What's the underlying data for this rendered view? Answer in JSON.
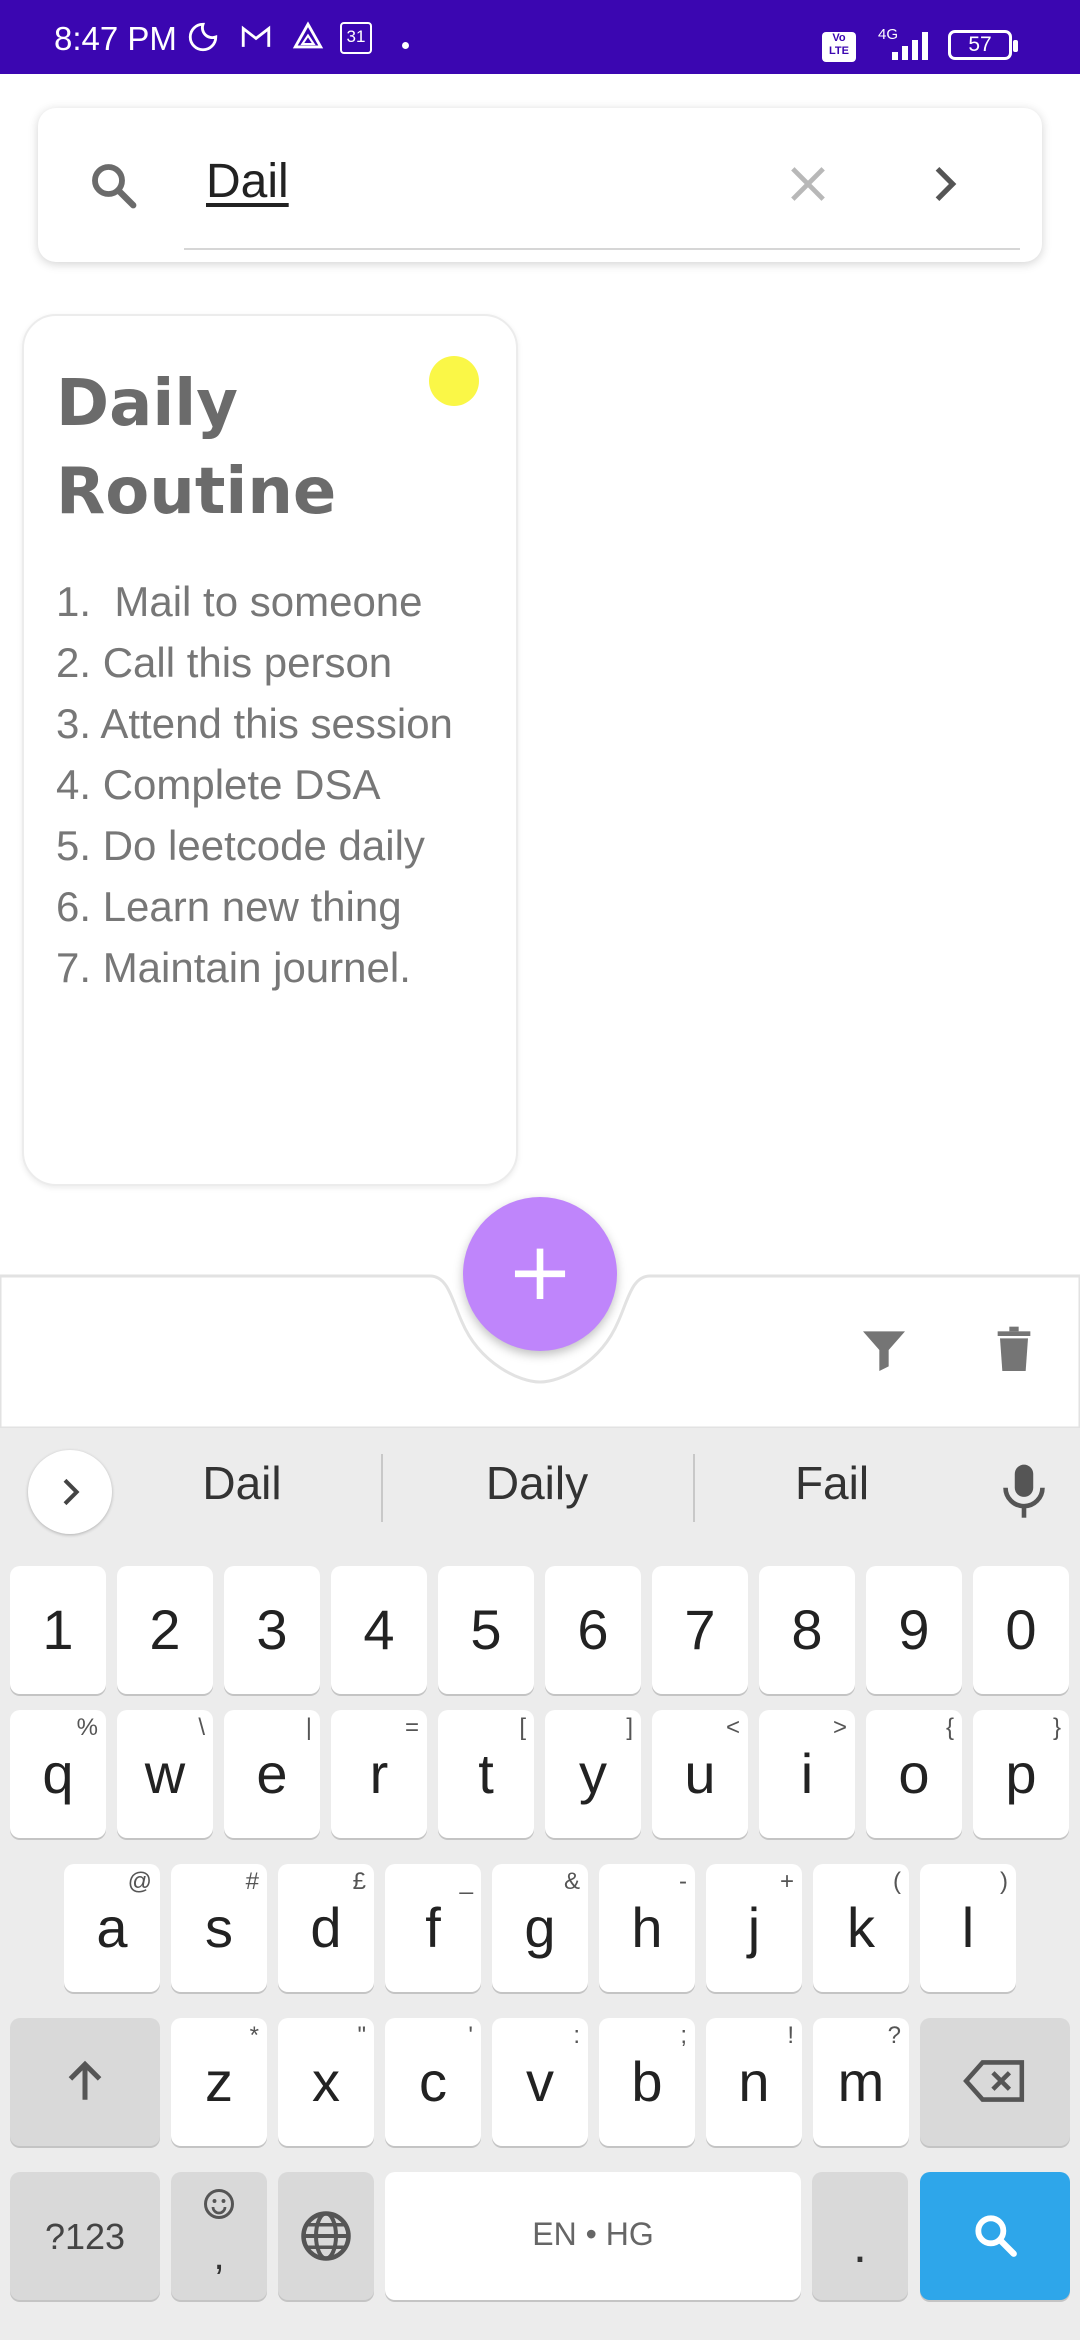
{
  "status_bar": {
    "time": "8:47 PM",
    "battery": "57",
    "network": "4G",
    "calendar_day": "31"
  },
  "search": {
    "query": "Dail"
  },
  "note": {
    "title": "Daily Routine",
    "body": "1.  Mail to someone\n2. Call this person\n3. Attend this session\n4. Complete DSA\n5. Do leetcode daily\n6. Learn new thing\n7. Maintain journel.",
    "color": "#faf747"
  },
  "fab": {
    "label": "+",
    "color": "#bf85fb"
  },
  "keyboard": {
    "suggestions": [
      "Dail",
      "Daily",
      "Fail"
    ],
    "number_row": [
      "1",
      "2",
      "3",
      "4",
      "5",
      "6",
      "7",
      "8",
      "9",
      "0"
    ],
    "row1": [
      {
        "k": "q",
        "a": "%"
      },
      {
        "k": "w",
        "a": "\\"
      },
      {
        "k": "e",
        "a": "|"
      },
      {
        "k": "r",
        "a": "="
      },
      {
        "k": "t",
        "a": "["
      },
      {
        "k": "y",
        "a": "]"
      },
      {
        "k": "u",
        "a": "<"
      },
      {
        "k": "i",
        "a": ">"
      },
      {
        "k": "o",
        "a": "{"
      },
      {
        "k": "p",
        "a": "}"
      }
    ],
    "row2": [
      {
        "k": "a",
        "a": "@"
      },
      {
        "k": "s",
        "a": "#"
      },
      {
        "k": "d",
        "a": "£"
      },
      {
        "k": "f",
        "a": "_"
      },
      {
        "k": "g",
        "a": "&"
      },
      {
        "k": "h",
        "a": "-"
      },
      {
        "k": "j",
        "a": "+"
      },
      {
        "k": "k",
        "a": "("
      },
      {
        "k": "l",
        "a": ")"
      }
    ],
    "row3": [
      {
        "k": "z",
        "a": "*"
      },
      {
        "k": "x",
        "a": "\""
      },
      {
        "k": "c",
        "a": "'"
      },
      {
        "k": "v",
        "a": ":"
      },
      {
        "k": "b",
        "a": ";"
      },
      {
        "k": "n",
        "a": "!"
      },
      {
        "k": "m",
        "a": "?"
      }
    ],
    "symbols_key": "?123",
    "comma_key": ",",
    "space_label": "EN • HG",
    "period_key": ".",
    "accent_color": "#2ea6ea"
  }
}
